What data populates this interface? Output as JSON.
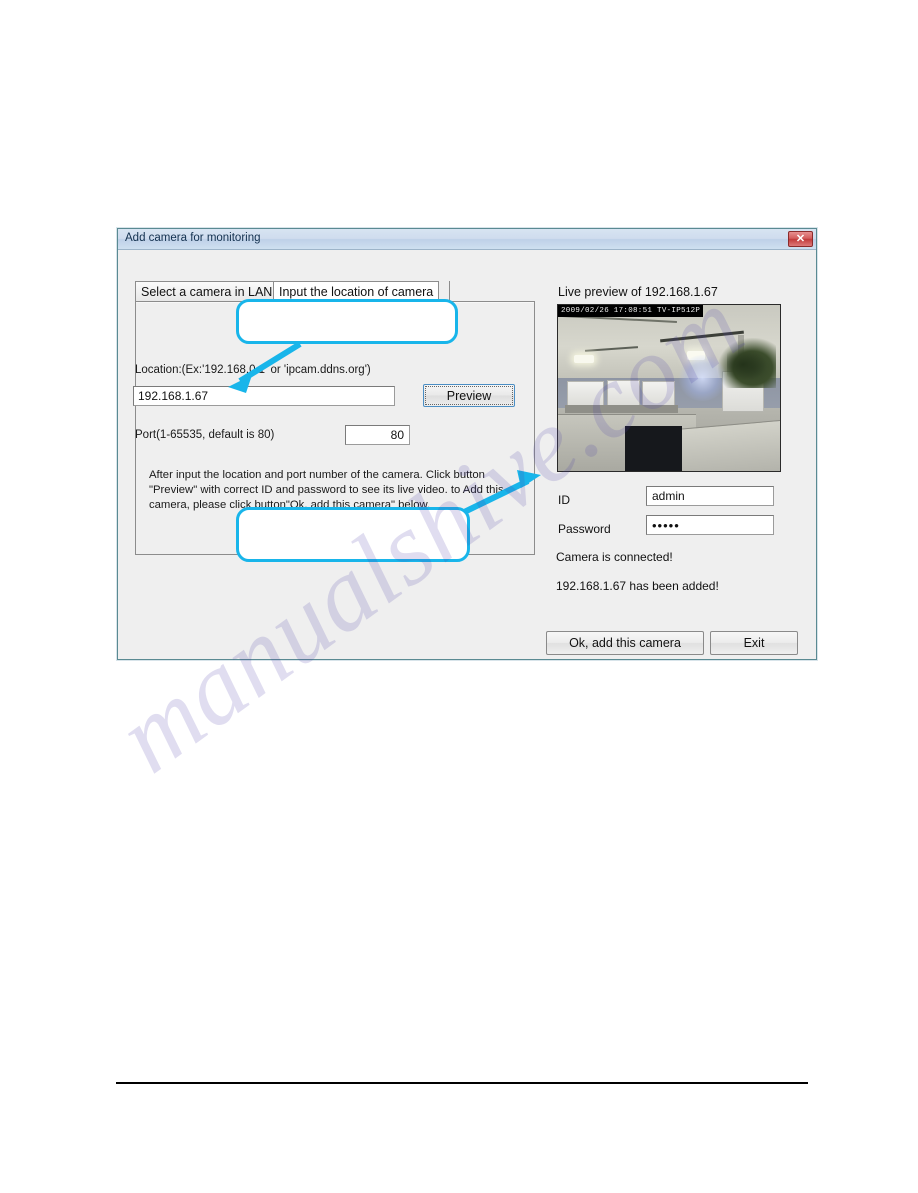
{
  "window": {
    "title": "Add camera for monitoring",
    "close_icon": "close-icon",
    "close_glyph": "✕"
  },
  "tabs": [
    {
      "label": "Select a camera in LAN",
      "active": false
    },
    {
      "label": "Input the location of camera",
      "active": true
    }
  ],
  "form": {
    "location_label": "Location:(Ex:'192.168.0.1' or 'ipcam.ddns.org')",
    "location_value": "192.168.1.67",
    "location_placeholder": "192.168.0.1",
    "preview_button": "Preview",
    "port_label": "Port(1-65535, default is 80)",
    "port_value": "80",
    "port_placeholder": "80",
    "instructions": "After input the location and port number of the camera. Click button \"Preview\" with correct ID and password to see its live video. to Add this camera, please click button\"Ok, add this camera\" below."
  },
  "preview": {
    "title": "Live preview of 192.168.1.67",
    "timestamp_overlay": "2009/02/26 17:08:51  TV-IP512P",
    "scene_description": "office-interior-ceiling-cubicles-plant"
  },
  "credentials": {
    "id_label": "ID",
    "id_value": "admin",
    "id_placeholder": "admin",
    "password_label": "Password",
    "password_value": "•••••",
    "password_placeholder": ""
  },
  "status": {
    "line1": "Camera is connected!",
    "line2": "192.168.1.67 has been added!"
  },
  "actions": {
    "ok_label": "Ok, add this camera",
    "exit_label": "Exit"
  },
  "annotations": {
    "callout_1_text": "",
    "callout_2_text": ""
  },
  "page": {
    "watermark": "manualshive.com"
  },
  "colors": {
    "annotation_cyan": "#18b5ea",
    "titlebar_blue": "#cfdcee",
    "close_red": "#c23b3b",
    "dialog_face": "#efefef",
    "watermark_purple": "#4b3ea8"
  }
}
